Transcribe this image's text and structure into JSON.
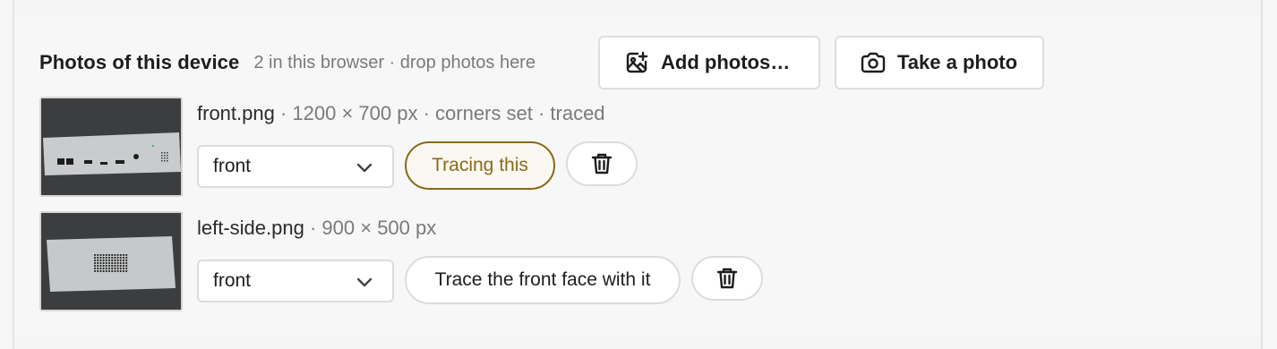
{
  "section": {
    "title": "Photos of this device",
    "hint": "2 in this browser · drop photos here"
  },
  "actions": {
    "add_photos_label": "Add photos…",
    "take_photo_label": "Take a photo"
  },
  "photos": [
    {
      "filename": "front.png",
      "details": "· 1200 × 700 px · corners set · traced",
      "face": "front",
      "trace_label": "Tracing this",
      "trace_state": "active"
    },
    {
      "filename": "left-side.png",
      "details": "· 900 × 500 px",
      "face": "front",
      "trace_label": "Trace the front face with it",
      "trace_state": "inactive"
    }
  ],
  "colors": {
    "accent": "#8a6a1c",
    "muted_text": "#7a7a7a",
    "border": "#dcdcdc"
  }
}
